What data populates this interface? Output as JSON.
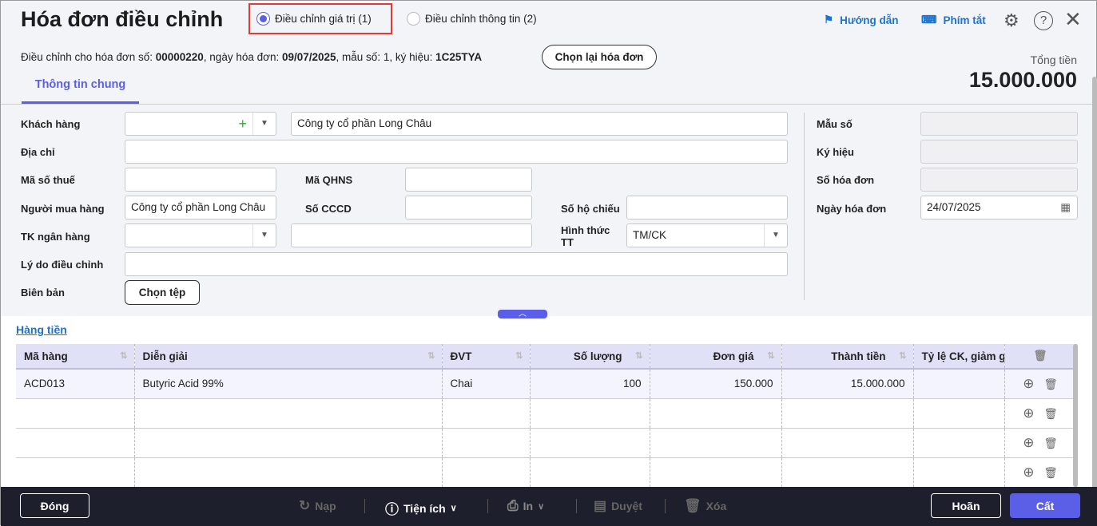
{
  "header": {
    "title": "Hóa đơn điều chỉnh",
    "radios": [
      {
        "label": "Điều chỉnh giá trị (1)",
        "selected": true
      },
      {
        "label": "Điều chỉnh thông tin (2)",
        "selected": false
      }
    ],
    "guide": "Hướng dẫn",
    "shortcuts": "Phím tắt",
    "ref_prefix": "Điều chỉnh cho hóa đơn số: ",
    "ref_number": "00000220",
    "ref_date_label": ", ngày hóa đơn: ",
    "ref_date": "09/07/2025",
    "ref_form_label": ", mẫu số: 1, ký hiệu: ",
    "ref_symbol": "1C25TYA",
    "reselect": "Chọn lại hóa đơn",
    "total_label": "Tổng tiền",
    "total": "15.000.000",
    "tab": "Thông tin chung"
  },
  "form": {
    "customer_label": "Khách hàng",
    "customer_name": "Công ty cổ phần Long Châu",
    "address_label": "Địa chỉ",
    "tax_label": "Mã số thuế",
    "qhns_label": "Mã QHNS",
    "buyer_label": "Người mua hàng",
    "buyer": "Công ty cổ phần Long Châu",
    "cccd_label": "Số CCCD",
    "passport_label": "Số hộ chiếu",
    "bank_label": "TK ngân hàng",
    "payment_label": "Hình thức TT",
    "payment": "TM/CK",
    "reason_label": "Lý do điều chỉnh",
    "record_label": "Biên bản",
    "choose_file": "Chọn tệp",
    "form_no_label": "Mẫu số",
    "symbol_label": "Ký hiệu",
    "invoice_no_label": "Số hóa đơn",
    "invoice_date_label": "Ngày hóa đơn",
    "invoice_date": "24/07/2025"
  },
  "grid": {
    "section": "Hàng tiền",
    "columns": [
      "Mã hàng",
      "Diễn giải",
      "ĐVT",
      "Số lượng",
      "Đơn giá",
      "Thành tiền",
      "Tỷ lệ CK, giảm giá"
    ],
    "rows": [
      [
        "ACD013",
        "Butyric Acid 99%",
        "Chai",
        "100",
        "150.000",
        "15.000.000",
        ""
      ],
      [
        "",
        "",
        "",
        "",
        "",
        "",
        ""
      ],
      [
        "",
        "",
        "",
        "",
        "",
        "",
        ""
      ],
      [
        "",
        "",
        "",
        "",
        "",
        "",
        ""
      ]
    ]
  },
  "footer": {
    "close": "Đóng",
    "reload": "Nạp",
    "utilities": "Tiện ích",
    "print": "In",
    "approve": "Duyệt",
    "delete": "Xóa",
    "cancel": "Hoãn",
    "save": "Cất"
  },
  "colors": {
    "accent": "#5b5fe8",
    "link": "#1a73d0",
    "footer_bg": "#1e1f2c"
  }
}
